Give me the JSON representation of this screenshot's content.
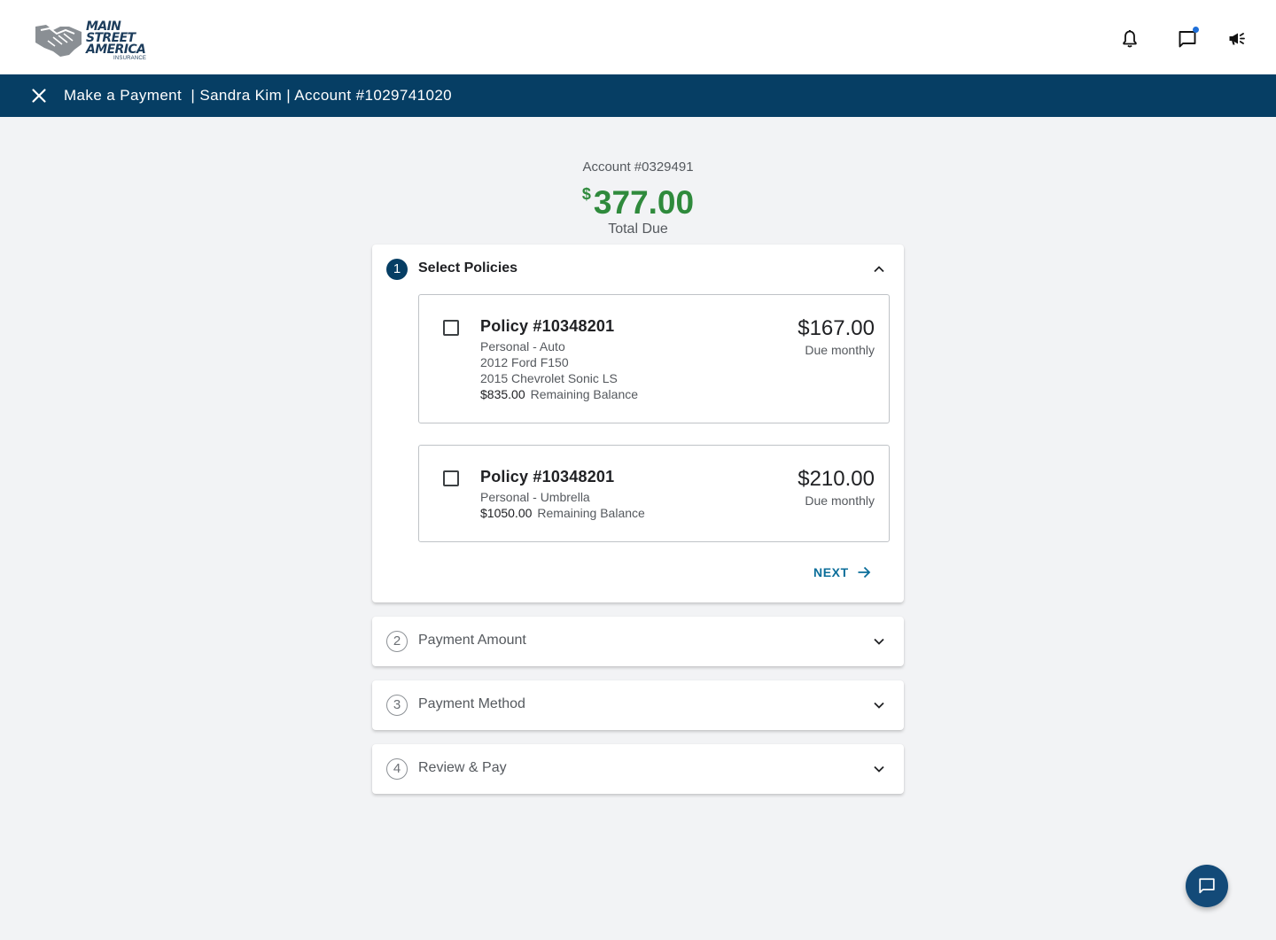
{
  "brand": {
    "logo_line1": "MAIN",
    "logo_line2": "STREET",
    "logo_line3": "AMERICA",
    "logo_sub": "INSURANCE"
  },
  "header": {
    "icons": [
      "bell-icon",
      "chat-icon",
      "megaphone-icon"
    ],
    "chat_has_notification": true
  },
  "titlebar": {
    "title": "Make a Payment  | Sandra Kim | Account #1029741020"
  },
  "summary": {
    "account_label": "Account #0329491",
    "currency": "$",
    "total_amount": "377.00",
    "total_label": "Total Due"
  },
  "steps": [
    {
      "number": "1",
      "title": "Select Policies",
      "expanded": true
    },
    {
      "number": "2",
      "title": "Payment Amount",
      "expanded": false
    },
    {
      "number": "3",
      "title": "Payment Method",
      "expanded": false
    },
    {
      "number": "4",
      "title": "Review & Pay",
      "expanded": false
    }
  ],
  "policies": [
    {
      "title": "Policy #10348201",
      "type": "Personal - Auto",
      "details": [
        "2012 Ford F150",
        "2015 Chevrolet Sonic LS"
      ],
      "remaining_amount": "$835.00",
      "remaining_label": "Remaining Balance",
      "amount": "$167.00",
      "frequency": "Due monthly",
      "checked": false
    },
    {
      "title": "Policy #10348201",
      "type": "Personal - Umbrella",
      "details": [],
      "remaining_amount": "$1050.00",
      "remaining_label": "Remaining Balance",
      "amount": "$210.00",
      "frequency": "Due monthly",
      "checked": false
    }
  ],
  "next_label": "NEXT",
  "colors": {
    "brand_navy": "#063e64",
    "total_green": "#2f8a3c",
    "link_teal": "#0b6e9a",
    "fab_blue": "#134a78"
  }
}
